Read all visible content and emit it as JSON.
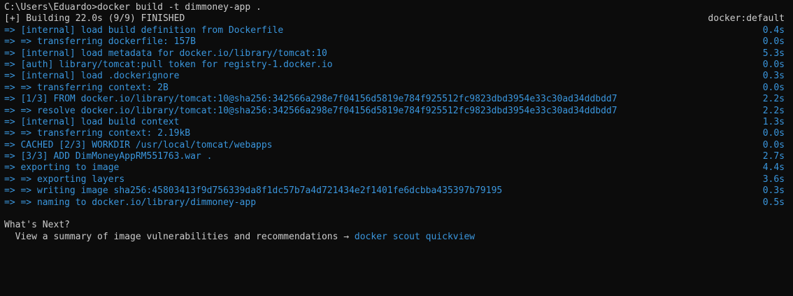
{
  "colors": {
    "background": "#0c0c0c",
    "text": "#cccccc",
    "accent_blue": "#3a96dd"
  },
  "command_line": "C:\\Users\\Eduardo>docker build -t dimmoney-app .",
  "status": {
    "text": "[+] Building 22.0s (9/9) FINISHED",
    "builder": "docker:default"
  },
  "steps": [
    {
      "text": "=> [internal] load build definition from Dockerfile",
      "time": "0.4s"
    },
    {
      "text": "=> => transferring dockerfile: 157B",
      "time": "0.0s"
    },
    {
      "text": "=> [internal] load metadata for docker.io/library/tomcat:10",
      "time": "5.3s"
    },
    {
      "text": "=> [auth] library/tomcat:pull token for registry-1.docker.io",
      "time": "0.0s"
    },
    {
      "text": "=> [internal] load .dockerignore",
      "time": "0.3s"
    },
    {
      "text": "=> => transferring context: 2B",
      "time": "0.0s"
    },
    {
      "text": "=> [1/3] FROM docker.io/library/tomcat:10@sha256:342566a298e7f04156d5819e784f925512fc9823dbd3954e33c30ad34ddbdd7",
      "time": "2.2s"
    },
    {
      "text": "=> => resolve docker.io/library/tomcat:10@sha256:342566a298e7f04156d5819e784f925512fc9823dbd3954e33c30ad34ddbdd7",
      "time": "2.2s"
    },
    {
      "text": "=> [internal] load build context",
      "time": "1.3s"
    },
    {
      "text": "=> => transferring context: 2.19kB",
      "time": "0.0s"
    },
    {
      "text": "=> CACHED [2/3] WORKDIR /usr/local/tomcat/webapps",
      "time": "0.0s"
    },
    {
      "text": "=> [3/3] ADD DimMoneyAppRM551763.war .",
      "time": "2.7s"
    },
    {
      "text": "=> exporting to image",
      "time": "4.4s"
    },
    {
      "text": "=> => exporting layers",
      "time": "3.6s"
    },
    {
      "text": "=> => writing image sha256:45803413f9d756339da8f1dc57b7a4d721434e2f1401fe6dcbba435397b79195",
      "time": "0.3s"
    },
    {
      "text": "=> => naming to docker.io/library/dimmoney-app",
      "time": "0.5s"
    }
  ],
  "next": {
    "heading": "What's Next?",
    "summary_prefix": "  View a summary of image vulnerabilities and recommendations → ",
    "summary_command": "docker scout quickview"
  }
}
